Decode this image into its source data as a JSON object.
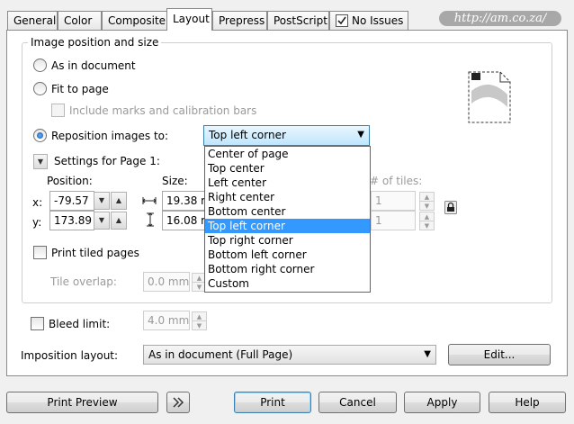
{
  "tabs": [
    {
      "label": "General"
    },
    {
      "label": "Color"
    },
    {
      "label": "Composite"
    },
    {
      "label": "Layout"
    },
    {
      "label": "Prepress"
    },
    {
      "label": "PostScript"
    },
    {
      "label": "No Issues"
    }
  ],
  "watermark_url": "http://am.co.za/",
  "group": {
    "title": "Image position and size",
    "as_in_document": "As in document",
    "fit_to_page": "Fit to page",
    "include_marks": "Include marks and calibration bars",
    "reposition_images": "Reposition images to:",
    "reposition_value": "Top left corner",
    "settings_for_page": "Settings for Page 1:",
    "position_label": "Position:",
    "size_label": "Size:",
    "tiles_label": "# of tiles:",
    "x_label": "x:",
    "y_label": "y:",
    "x_value": "-79.57",
    "y_value": "173.89",
    "width_value": "19.38 mm",
    "height_value": "16.08 mm",
    "tiles_x": "1",
    "tiles_y": "1",
    "print_tiled": "Print tiled pages",
    "tile_overlap_label": "Tile overlap:",
    "tile_overlap_value": "0.0 mm"
  },
  "dropdown_options": [
    "Center of page",
    "Top center",
    "Left center",
    "Right center",
    "Bottom center",
    "Top left corner",
    "Top right corner",
    "Bottom left corner",
    "Bottom right corner",
    "Custom"
  ],
  "dropdown_selected_index": 5,
  "bleed": {
    "label": "Bleed limit:",
    "value": "4.0 mm"
  },
  "imposition": {
    "label": "Imposition layout:",
    "value": "As in document (Full Page)",
    "edit_button": "Edit..."
  },
  "footer": {
    "print_preview": "Print Preview",
    "print": "Print",
    "cancel": "Cancel",
    "apply": "Apply",
    "help": "Help"
  }
}
